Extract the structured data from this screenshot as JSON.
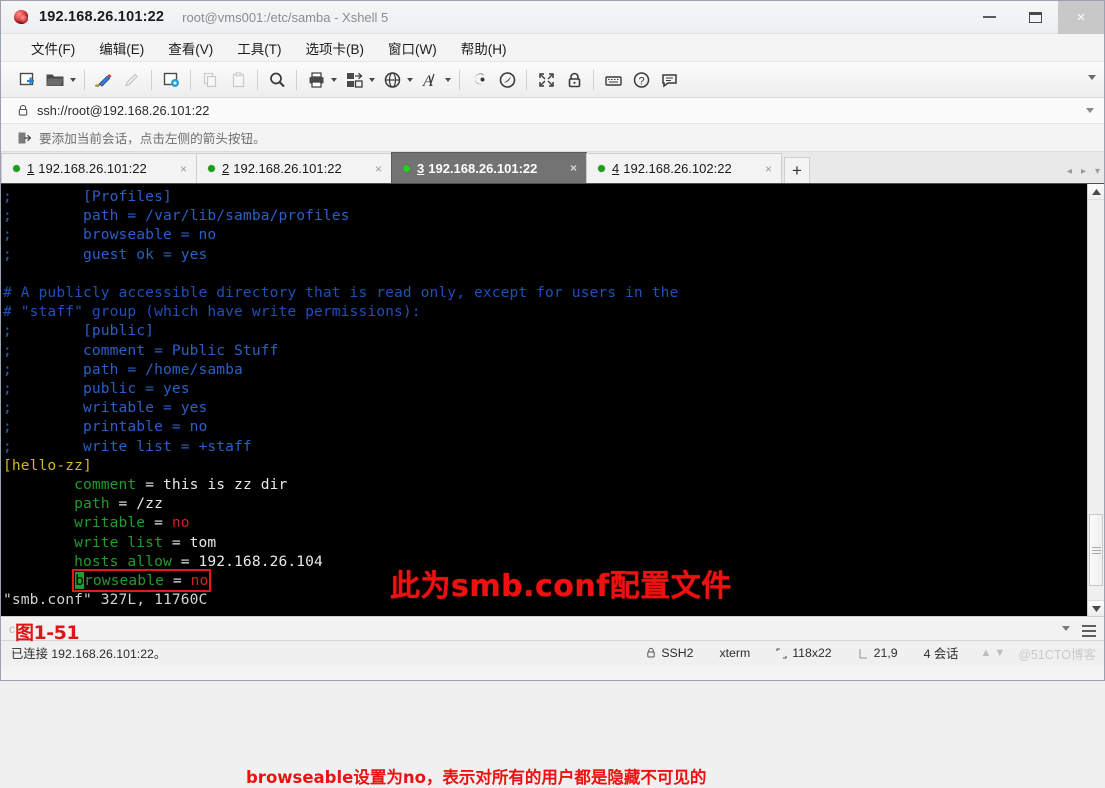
{
  "window": {
    "title": "192.168.26.101:22",
    "subtitle": "root@vms001:/etc/samba - Xshell 5",
    "minimize": "—",
    "maximize": "□",
    "close": "×"
  },
  "menubar": {
    "items": [
      "文件(F)",
      "编辑(E)",
      "查看(V)",
      "工具(T)",
      "选项卡(B)",
      "窗口(W)",
      "帮助(H)"
    ]
  },
  "toolbar": {
    "icons": [
      "new-session-icon",
      "open-folder-icon",
      "open-folder-dropdown-caret",
      "paint-brush-icon",
      "pencil-disabled-icon",
      "session-properties-icon",
      "copy-disabled-icon",
      "paste-disabled-icon",
      "find-icon",
      "print-icon",
      "print-dropdown-caret",
      "transfer-file-icon",
      "transfer-dropdown-caret",
      "globe-icon",
      "globe-dropdown-caret",
      "font-icon",
      "font-dropdown-caret",
      "ssh-tunnel-icon",
      "compose-icon",
      "fullscreen-icon",
      "lock-icon",
      "keyboard-icon",
      "help-icon",
      "feedback-icon"
    ],
    "overflow": "toolbar-overflow-caret"
  },
  "address": {
    "icon": "lock-icon",
    "value": "ssh://root@192.168.26.101:22"
  },
  "hint": {
    "icon": "add-session-icon",
    "text": "要添加当前会话，点击左侧的箭头按钮。"
  },
  "tabs": {
    "items": [
      {
        "num": "1",
        "label": "192.168.26.101:22",
        "active": false,
        "close": "×"
      },
      {
        "num": "2",
        "label": "192.168.26.101:22",
        "active": false,
        "close": "×"
      },
      {
        "num": "3",
        "label": "192.168.26.101:22",
        "active": true,
        "close": "×"
      },
      {
        "num": "4",
        "label": "192.168.26.102:22",
        "active": false,
        "close": "×"
      }
    ],
    "new_tab": "+",
    "nav_prev": "◂",
    "nav_next": "▸",
    "nav_menu": "▾"
  },
  "terminal": {
    "lines": [
      [
        {
          "t": ";",
          "c": "cmt"
        },
        {
          "t": "        [Profiles]",
          "c": "cmt"
        }
      ],
      [
        {
          "t": ";",
          "c": "cmt"
        },
        {
          "t": "        path = /var/lib/samba/profiles",
          "c": "cmt"
        }
      ],
      [
        {
          "t": ";",
          "c": "cmt"
        },
        {
          "t": "        browseable = no",
          "c": "cmt"
        }
      ],
      [
        {
          "t": ";",
          "c": "cmt"
        },
        {
          "t": "        guest ok = yes",
          "c": "cmt"
        }
      ],
      [
        {
          "t": "",
          "c": "cmt"
        }
      ],
      [
        {
          "t": "# A publicly accessible directory that is read only, except for users in the",
          "c": "hash"
        }
      ],
      [
        {
          "t": "# \"staff\" group (which have write permissions):",
          "c": "hash"
        }
      ],
      [
        {
          "t": ";",
          "c": "cmt"
        },
        {
          "t": "        [public]",
          "c": "cmt"
        }
      ],
      [
        {
          "t": ";",
          "c": "cmt"
        },
        {
          "t": "        comment = Public Stuff",
          "c": "cmt"
        }
      ],
      [
        {
          "t": ";",
          "c": "cmt"
        },
        {
          "t": "        path = /home/samba",
          "c": "cmt"
        }
      ],
      [
        {
          "t": ";",
          "c": "cmt"
        },
        {
          "t": "        public = yes",
          "c": "cmt"
        }
      ],
      [
        {
          "t": ";",
          "c": "cmt"
        },
        {
          "t": "        writable = yes",
          "c": "cmt"
        }
      ],
      [
        {
          "t": ";",
          "c": "cmt"
        },
        {
          "t": "        printable = no",
          "c": "cmt"
        }
      ],
      [
        {
          "t": ";",
          "c": "cmt"
        },
        {
          "t": "        write list = +staff",
          "c": "cmt"
        }
      ],
      [
        {
          "t": "[hello-zz]",
          "c": "sect"
        }
      ],
      [
        {
          "t": "        ",
          "c": "val"
        },
        {
          "t": "comment",
          "c": "key"
        },
        {
          "t": " = this is zz dir",
          "c": "val"
        }
      ],
      [
        {
          "t": "        ",
          "c": "val"
        },
        {
          "t": "path",
          "c": "key"
        },
        {
          "t": " = /zz",
          "c": "val"
        }
      ],
      [
        {
          "t": "        ",
          "c": "val"
        },
        {
          "t": "writable",
          "c": "key"
        },
        {
          "t": " = ",
          "c": "val"
        },
        {
          "t": "no",
          "c": "red"
        }
      ],
      [
        {
          "t": "        ",
          "c": "val"
        },
        {
          "t": "write list",
          "c": "key"
        },
        {
          "t": " = tom",
          "c": "val"
        }
      ],
      [
        {
          "t": "        ",
          "c": "val"
        },
        {
          "t": "hosts allow",
          "c": "key"
        },
        {
          "t": " = 192.168.26.104",
          "c": "val"
        }
      ],
      [
        {
          "t": "        ",
          "c": "val"
        },
        {
          "t": "browseable",
          "c": "key",
          "box": true,
          "cursor": "b"
        },
        {
          "t": " = ",
          "c": "val",
          "box": true
        },
        {
          "t": "no",
          "c": "red",
          "box": true
        }
      ],
      [
        {
          "t": "\"smb.conf\" 327L, 11760C",
          "c": "grey"
        }
      ]
    ],
    "annotation_title": "此为smb.conf配置文件",
    "annotation_note": "browseable设置为no，表示对所有的用户都是隐藏不可见的"
  },
  "cmdbar": {
    "caption": "图1-51",
    "faint": "c"
  },
  "statusbar": {
    "connected": "已连接 192.168.26.101:22。",
    "protocol": "SSH2",
    "term_type": "xterm",
    "size": "118x22",
    "cursor": "21,9",
    "sessions": "4 会话",
    "watermark": "@51CTO博客"
  },
  "colors": {
    "accent_red": "#ef1111",
    "tab_active_bg": "#737373",
    "terminal_bg": "#000000",
    "dot_green": "#18a018"
  }
}
